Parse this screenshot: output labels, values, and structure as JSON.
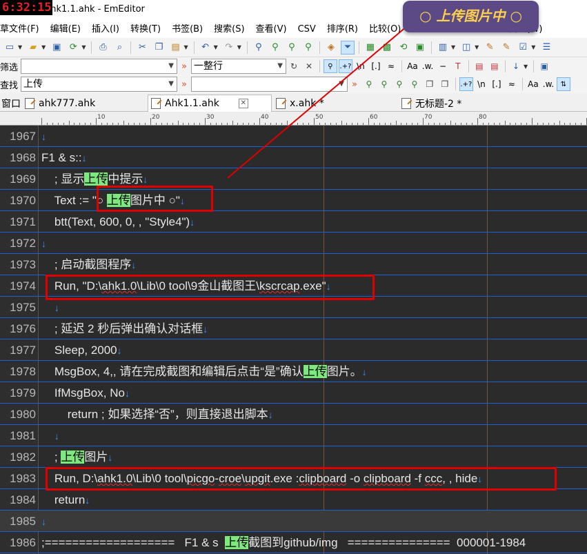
{
  "window": {
    "clock": "6:32:15",
    "title": "\\Ahk1.1.ahk - EmEditor"
  },
  "tooltip": {
    "text": "○ 上传图片中 ○",
    "color": "#ffd14a",
    "background": "#5c4a86"
  },
  "menu": {
    "items": [
      "草文件(F)",
      "编辑(E)",
      "插入(I)",
      "转换(T)",
      "书签(B)",
      "搜索(S)",
      "查看(V)",
      "CSV",
      "排序(R)",
      "比较(O)"
    ],
    "trailing": "窗口(W)"
  },
  "filter_row": {
    "label": "筛选",
    "value": "",
    "mode": "一整行"
  },
  "find_row": {
    "label": "查找",
    "value": "上传"
  },
  "tabs": [
    {
      "label": "窗口",
      "active": false
    },
    {
      "label": "ahk777.ahk",
      "active": false
    },
    {
      "label": "Ahk1.1.ahk",
      "active": true
    },
    {
      "label": "x.ahk *",
      "active": false
    },
    {
      "label": "无标题-2 *",
      "active": false
    }
  ],
  "ruler": {
    "labels": [
      "10",
      "20",
      "30",
      "40",
      "50",
      "60",
      "70",
      "80"
    ]
  },
  "editor": {
    "current_line": "1985",
    "lines": [
      {
        "n": "1967",
        "pre": "",
        "hl": "",
        "post": ""
      },
      {
        "n": "1968",
        "pre": "F1 & s::",
        "hl": "",
        "post": ""
      },
      {
        "n": "1969",
        "pre": "    ; 显示",
        "hl": "上传",
        "post": "中提示"
      },
      {
        "n": "1970",
        "pre": "    Text := \"○ ",
        "hl": "上传",
        "post": "图片中 ○\""
      },
      {
        "n": "1971",
        "pre": "    btt(Text, 600, 0, , \"Style4\")",
        "hl": "",
        "post": ""
      },
      {
        "n": "1972",
        "pre": "",
        "hl": "",
        "post": ""
      },
      {
        "n": "1973",
        "pre": "    ; 启动截图程序",
        "hl": "",
        "post": ""
      },
      {
        "n": "1974",
        "pre": "    Run, \"D:\\ahk1.0\\Lib\\0 tool\\9金山截图王\\kscrcap.exe\"",
        "hl": "",
        "post": ""
      },
      {
        "n": "1975",
        "pre": "    ",
        "hl": "",
        "post": ""
      },
      {
        "n": "1976",
        "pre": "    ; 延迟 2 秒后弹出确认对话框",
        "hl": "",
        "post": ""
      },
      {
        "n": "1977",
        "pre": "    Sleep, 2000",
        "hl": "",
        "post": ""
      },
      {
        "n": "1978",
        "pre": "    MsgBox, 4,, 请在完成截图和编辑后点击“是”确认",
        "hl": "上传",
        "post": "图片。"
      },
      {
        "n": "1979",
        "pre": "    IfMsgBox, No",
        "hl": "",
        "post": ""
      },
      {
        "n": "1980",
        "pre": "        return ; 如果选择“否”，则直接退出脚本",
        "hl": "",
        "post": ""
      },
      {
        "n": "1981",
        "pre": "    ",
        "hl": "",
        "post": ""
      },
      {
        "n": "1982",
        "pre": "    ; ",
        "hl": "上传",
        "post": "图片"
      },
      {
        "n": "1983",
        "pre": "    Run, D:\\ahk1.0\\Lib\\0 tool\\picgo-croe\\upgit.exe :clipboard -o clipboard -f ccc, , hide",
        "hl": "",
        "post": ""
      },
      {
        "n": "1984",
        "pre": "    return",
        "hl": "",
        "post": ""
      },
      {
        "n": "1985",
        "pre": "",
        "hl": "",
        "post": ""
      },
      {
        "n": "1986",
        "pre": ";===================   F1 & s  ",
        "hl": "上传",
        "post": "截图到github/img   ===============  000001-1984"
      }
    ]
  }
}
